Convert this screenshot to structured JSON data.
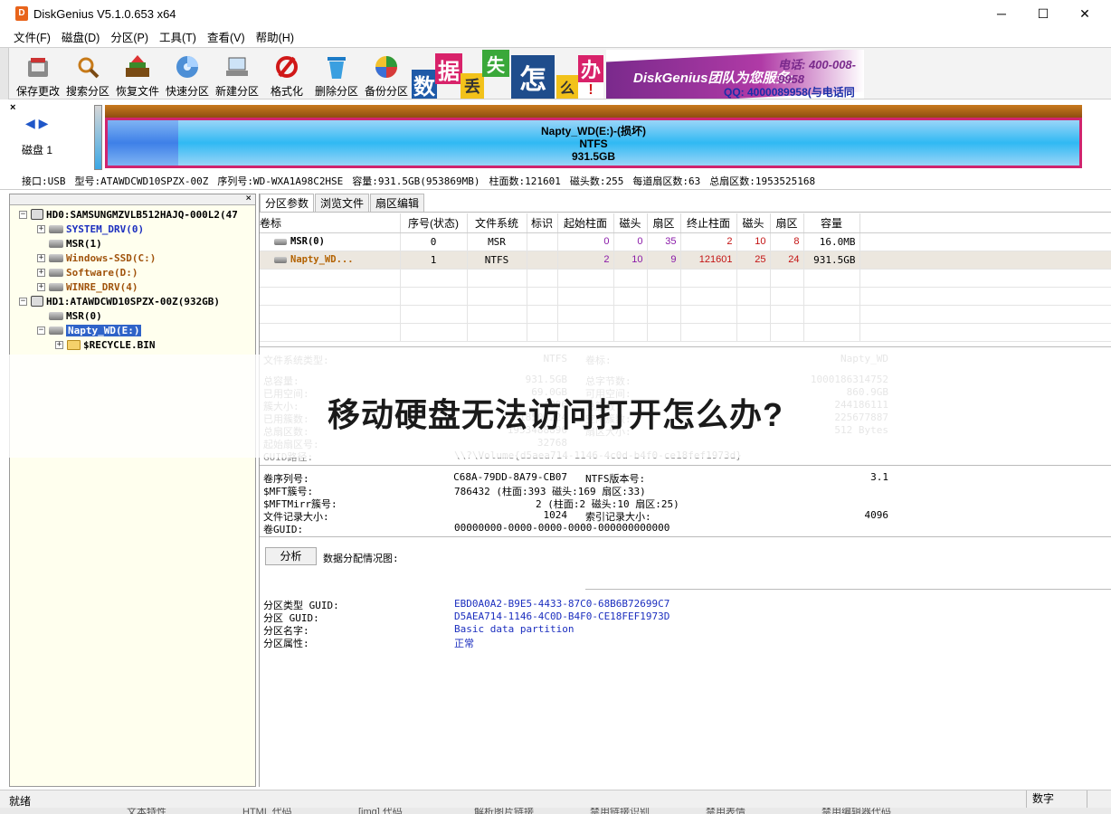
{
  "window": {
    "title": "DiskGenius V5.1.0.653 x64",
    "icon_name": "diskgenius-logo-icon",
    "min_glyph": "─",
    "max_glyph": "☐",
    "close_glyph": "✕"
  },
  "menu": [
    "文件(F)",
    "磁盘(D)",
    "分区(P)",
    "工具(T)",
    "查看(V)",
    "帮助(H)"
  ],
  "toolbar": {
    "buttons": [
      {
        "label": "保存更改",
        "icon": "save-disk-icon"
      },
      {
        "label": "搜索分区",
        "icon": "magnifier-icon"
      },
      {
        "label": "恢复文件",
        "icon": "recover-files-icon"
      },
      {
        "label": "快速分区",
        "icon": "quick-partition-icon"
      },
      {
        "label": "新建分区",
        "icon": "new-partition-icon"
      },
      {
        "label": "格式化",
        "icon": "format-icon"
      },
      {
        "label": "删除分区",
        "icon": "recycle-bin-icon"
      },
      {
        "label": "备份分区",
        "icon": "backup-icon"
      }
    ],
    "banner": {
      "chars": [
        "数",
        "据",
        "丢",
        "失",
        "怎",
        "么",
        "办",
        "!"
      ],
      "line1": "DiskGenius团队为您服务:",
      "line2": "电话: 400-008-9958",
      "line3": "QQ: 4000089958(与电话同号)"
    }
  },
  "diskmap": {
    "nav_left": "◀",
    "nav_right": "▶",
    "disk_label": "磁盘 1",
    "partition": {
      "name": "Napty_WD(E:)-(损坏)",
      "fs": "NTFS",
      "size": "931.5GB"
    },
    "used_fraction": 0.072
  },
  "diskinfo": [
    "接口:USB",
    "型号:ATAWDCWD10SPZX-00Z",
    "序列号:WD-WXA1A98C2HSE",
    "容量:931.5GB(953869MB)",
    "柱面数:121601",
    "磁头数:255",
    "每道扇区数:63",
    "总扇区数:1953525168"
  ],
  "tree": [
    {
      "label": "HD0:SAMSUNGMZVLB512HAJQ-000L2(47",
      "color": "black",
      "indent": 0,
      "expander": "⊟",
      "icon": "disk"
    },
    {
      "label": "SYSTEM_DRV(0)",
      "color": "blue",
      "indent": 1,
      "expander": "⊞",
      "icon": "part"
    },
    {
      "label": "MSR(1)",
      "color": "black",
      "indent": 1,
      "expander": "",
      "icon": "part"
    },
    {
      "label": "Windows-SSD(C:)",
      "color": "brown",
      "indent": 1,
      "expander": "⊞",
      "icon": "part"
    },
    {
      "label": "Software(D:)",
      "color": "brown",
      "indent": 1,
      "expander": "⊞",
      "icon": "part"
    },
    {
      "label": "WINRE_DRV(4)",
      "color": "brown",
      "indent": 1,
      "expander": "⊞",
      "icon": "part"
    },
    {
      "label": "HD1:ATAWDCWD10SPZX-00Z(932GB)",
      "color": "black",
      "indent": 0,
      "expander": "⊟",
      "icon": "disk"
    },
    {
      "label": "MSR(0)",
      "color": "black",
      "indent": 1,
      "expander": "",
      "icon": "part"
    },
    {
      "label": "Napty_WD(E:)",
      "color": "sel",
      "indent": 1,
      "expander": "⊟",
      "icon": "part"
    },
    {
      "label": "$RECYCLE.BIN",
      "color": "black",
      "indent": 2,
      "expander": "⊞",
      "icon": "folder"
    }
  ],
  "tabs": [
    "分区参数",
    "浏览文件",
    "扇区编辑"
  ],
  "table": {
    "headers": [
      "卷标",
      "序号(状态)",
      "文件系统",
      "标识",
      "起始柱面",
      "磁头",
      "扇区",
      "终止柱面",
      "磁头",
      "扇区",
      "容量"
    ],
    "rows": [
      [
        "MSR(0)",
        "0",
        "MSR",
        "",
        "0",
        "0",
        "35",
        "2",
        "10",
        "8",
        "16.0MB"
      ],
      [
        "Napty_WD...",
        "1",
        "NTFS",
        "",
        "2",
        "10",
        "9",
        "121601",
        "25",
        "24",
        "931.5GB"
      ]
    ]
  },
  "details": {
    "fs_type_label": "文件系统类型:",
    "fs_type": "NTFS",
    "vol_label_label": "卷标:",
    "vol_label": "Napty_WD",
    "total_label": "总容量:",
    "total": "931.5GB",
    "total_bytes_label": "总字节数:",
    "total_bytes": "1000186314752",
    "used_label": "已用空间:",
    "used": "69.0GB",
    "free_label": "可用空间:",
    "free": "860.9GB",
    "cluster_label": "簇大小:",
    "cluster": "4096",
    "total_clusters_label": "总簇数:",
    "total_clusters": "244186111",
    "used_clusters_label": "已用簇数:",
    "used_clusters": "18508224",
    "free_clusters_label": "空闲簇数:",
    "free_clusters": "225677887",
    "total_sectors_label": "总扇区数:",
    "total_sectors": "1953488896",
    "sector_size_label": "扇区大小:",
    "sector_size": "512 Bytes",
    "start_sector_label": "起始扇区号:",
    "start_sector": "32768",
    "guid_path_label": "GUID路径:",
    "guid_path": "\\\\?\\Volume{d5aea714-1146-4c0d-b4f0-ce18fef1973d}",
    "serial_label": "卷序列号:",
    "serial": "C68A-79DD-8A79-CB07",
    "ntfs_ver_label": "NTFS版本号:",
    "ntfs_ver": "3.1",
    "mft_label": "$MFT簇号:",
    "mft": "786432 (柱面:393 磁头:169 扇区:33)",
    "mftmirr_label": "$MFTMirr簇号:",
    "mftmirr": "2 (柱面:2 磁头:10 扇区:25)",
    "record_label": "文件记录大小:",
    "record": "1024",
    "index_label": "索引记录大小:",
    "index": "4096",
    "vol_guid_label": "卷GUID:",
    "vol_guid": "00000000-0000-0000-0000-000000000000",
    "analyze": "分析",
    "alloc_label": "数据分配情况图:",
    "ptype_guid_label": "分区类型 GUID:",
    "ptype_guid": "EBD0A0A2-B9E5-4433-87C0-68B6B72699C7",
    "pguid_label": "分区 GUID:",
    "pguid": "D5AEA714-1146-4C0D-B4F0-CE18FEF1973D",
    "pname_label": "分区名字:",
    "pname": "Basic data partition",
    "pattr_label": "分区属性:",
    "pattr": "正常"
  },
  "overlay_title": "移动硬盘无法访问打开怎么办?",
  "status": {
    "left": "就绪",
    "right": "数字"
  },
  "bottom_strip": [
    "文本特性",
    "HTML 代码",
    "[img] 代码",
    "解析图片链接",
    "禁用链接识别",
    "禁用表情",
    "禁用编辑器代码"
  ]
}
